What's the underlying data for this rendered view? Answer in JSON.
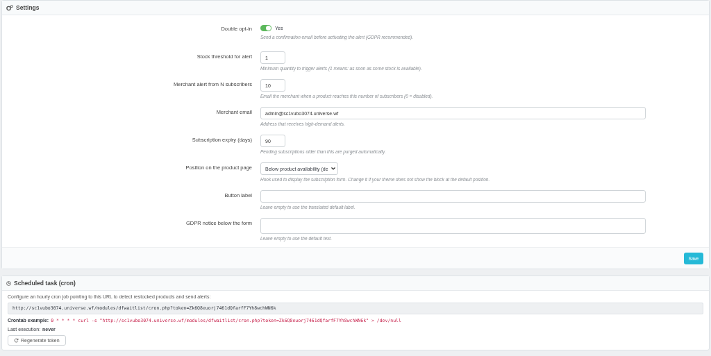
{
  "settings_panel": {
    "title": "Settings",
    "fields": [
      {
        "kind": "switch",
        "label": "Double opt-in",
        "on": true,
        "value": "Yes",
        "help": "Send a confirmation email before activating the alert (GDPR recommended)."
      },
      {
        "kind": "number",
        "label": "Stock threshold for alert",
        "value": "1",
        "help": "Minimum quantity to trigger alerts (1 means: as soon as some stock is available)."
      },
      {
        "kind": "number",
        "label": "Merchant alert from N subscribers",
        "value": "10",
        "help": "Email the merchant when a product reaches this number of subscribers (0 = disabled)."
      },
      {
        "kind": "text",
        "label": "Merchant email",
        "value": "admin@sc1vubo3074.universe.wf",
        "help": "Address that receives high-demand alerts."
      },
      {
        "kind": "number",
        "label": "Subscription expiry (days)",
        "value": "90",
        "help": "Pending subscriptions older than this are purged automatically."
      },
      {
        "kind": "select",
        "label": "Position on the product page",
        "value": "Below product availability (de",
        "help": "Hook used to display the subscription form. Change it if your theme does not show the block at the default position."
      },
      {
        "kind": "text",
        "label": "Button label",
        "help": "Leave empty to use the translated default label."
      },
      {
        "kind": "textarea",
        "label": "GDPR notice below the form",
        "help": "Leave empty to use the default text."
      }
    ],
    "save_button": "Save"
  },
  "cron_panel": {
    "title": "Scheduled task (cron)",
    "intro": "Configure an hourly cron job pointing to this URL to detect restocked products and send alerts:",
    "url": "http://sc1vubo3074.universe.wf/modules/dfwaitlist/cron.php?token=Zk6Q8euorj7461dQfarfF7Yh8wchWN6k",
    "crontab_label": "Crontab example:",
    "crontab": "0 * * * * curl -s \"http://sc1vubo3074.universe.wf/modules/dfwaitlist/cron.php?token=Zk6Q8euorj7461dQfarfF7Yh8wchWN6k\" > /dev/null",
    "last_execution_label": "Last execution:",
    "last_execution": "never",
    "regenerate_button": "Regenerate token"
  }
}
